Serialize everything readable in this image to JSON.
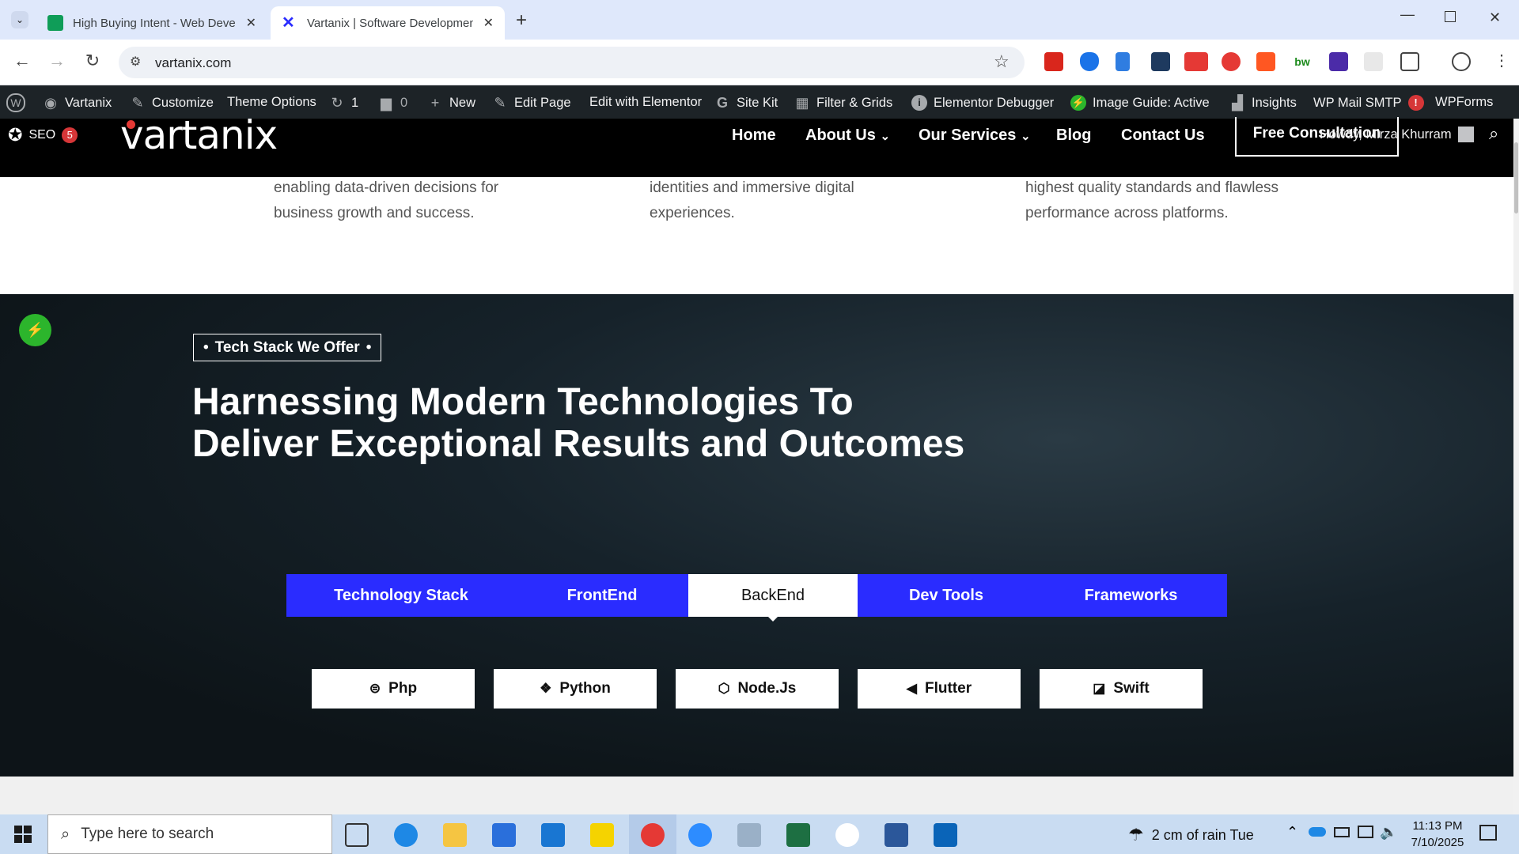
{
  "browser": {
    "tabs": [
      {
        "title": "High Buying Intent - Web Deve"
      },
      {
        "title": "Vartanix | Software Developmen"
      }
    ],
    "url": "vartanix.com"
  },
  "wpbar": {
    "site": "Vartanix",
    "customize": "Customize",
    "theme_options": "Theme Options",
    "updates": "1",
    "comments": "0",
    "new": "New",
    "edit_page": "Edit Page",
    "edit_elementor": "Edit with Elementor",
    "site_kit": "Site Kit",
    "filter": "Filter & Grids",
    "debugger": "Elementor Debugger",
    "image_guide": "Image Guide: Active",
    "insights": "Insights",
    "mail": "WP Mail SMTP",
    "mail_badge": "!",
    "wpforms": "WPForms",
    "howdy": "Howdy, Mirza Khurram",
    "seo": "SEO",
    "seo_badge": "5"
  },
  "site": {
    "logo": "vartanix",
    "nav": [
      "Home",
      "About Us",
      "Our Services",
      "Blog",
      "Contact Us"
    ],
    "cta": "Free Consultation"
  },
  "cards": [
    {
      "line1": "enabling data-driven decisions for",
      "line2": "business growth and success."
    },
    {
      "line1": "identities and immersive digital",
      "line2": "experiences."
    },
    {
      "line1": "highest quality standards and flawless",
      "line2": "performance across platforms."
    }
  ],
  "hero": {
    "tag": "Tech Stack We Offer",
    "title_line1": "Harnessing Modern Technologies To",
    "title_line2": "Deliver Exceptional Results and Outcomes",
    "tabs": [
      "Technology Stack",
      "FrontEnd",
      "BackEnd",
      "Dev Tools",
      "Frameworks"
    ],
    "active_tab": "BackEnd",
    "chips": [
      {
        "label": "Php",
        "icon": "php-icon"
      },
      {
        "label": "Python",
        "icon": "python-icon"
      },
      {
        "label": "Node.Js",
        "icon": "nodejs-icon"
      },
      {
        "label": "Flutter",
        "icon": "flutter-icon"
      },
      {
        "label": "Swift",
        "icon": "swift-icon"
      }
    ]
  },
  "taskbar": {
    "search_placeholder": "Type here to search",
    "weather": "2 cm of rain Tue",
    "time": "11:13 PM",
    "date": "7/10/2025"
  },
  "colors": {
    "accent_blue": "#2a2cff",
    "header_black": "#000000",
    "wp_bar": "#1d2327"
  }
}
